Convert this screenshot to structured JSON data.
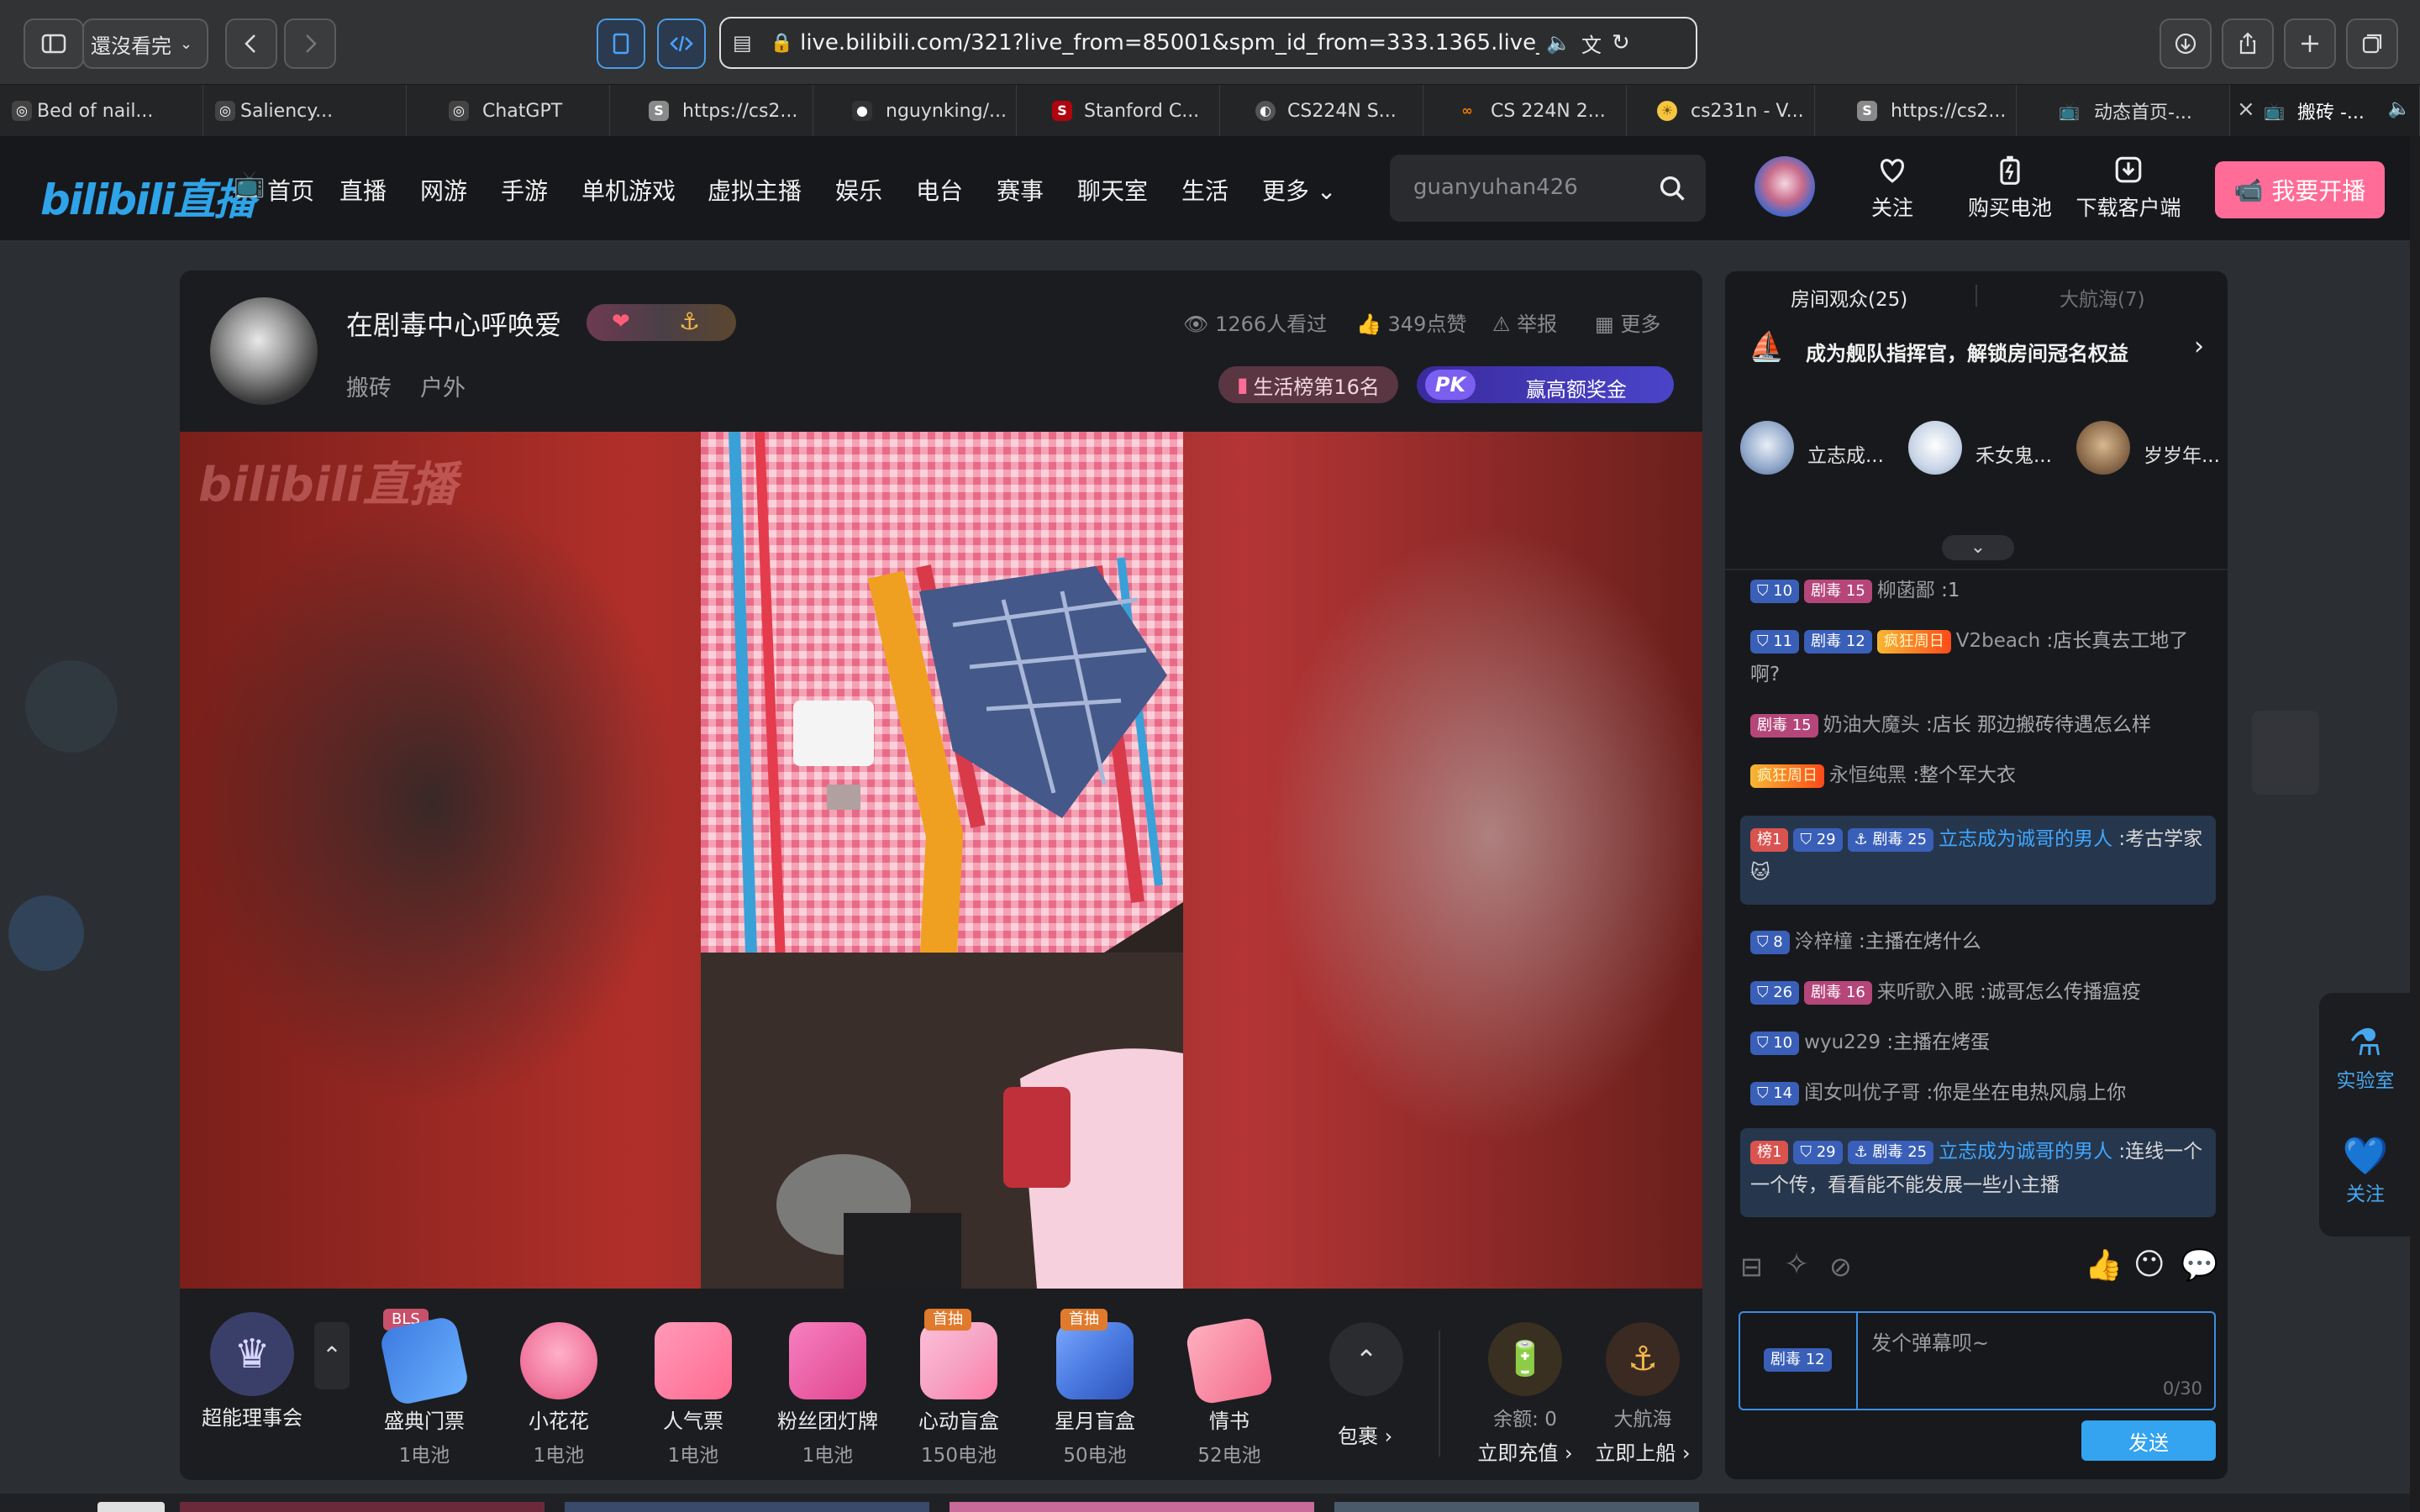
{
  "browser": {
    "reader_label": "還沒看完",
    "url": "live.bilibili.com/321?live_from=85001&spm_id_from=333.1365.live_users",
    "tabs": [
      {
        "title": "Bed of nail...",
        "icon": "chatgpt-icon",
        "color": "#ffffff"
      },
      {
        "title": "Saliency...",
        "icon": "chatgpt-icon",
        "color": "#ffffff"
      },
      {
        "title": "ChatGPT",
        "icon": "chatgpt-icon",
        "color": "#ffffff"
      },
      {
        "title": "https://cs2...",
        "icon": "s-icon",
        "color": "#8a8a8a"
      },
      {
        "title": "nguynking/...",
        "icon": "github-icon",
        "color": "#ffffff"
      },
      {
        "title": "Stanford C...",
        "icon": "stanford-icon",
        "color": "#b1040e"
      },
      {
        "title": "CS224N S...",
        "icon": "circle-icon",
        "color": "#ffffff"
      },
      {
        "title": "CS 224N 2...",
        "icon": "infinity-icon",
        "color": "#f57c00"
      },
      {
        "title": "cs231n - V...",
        "icon": "sun-icon",
        "color": "#f5c542"
      },
      {
        "title": "https://cs2...",
        "icon": "s-icon",
        "color": "#8a8a8a"
      },
      {
        "title": "动态首页-...",
        "icon": "bilibili-icon",
        "color": "#2fa3e8"
      },
      {
        "title": "搬砖 -...",
        "icon": "bilibili-icon",
        "color": "#2fa3e8"
      }
    ]
  },
  "header": {
    "logo": "bilibili直播",
    "nav": [
      "首页",
      "直播",
      "网游",
      "手游",
      "单机游戏",
      "虚拟主播",
      "娱乐",
      "电台",
      "赛事",
      "聊天室",
      "生活",
      "更多"
    ],
    "search_placeholder": "guanyuhan426",
    "actions": [
      "关注",
      "购买电池",
      "下载客户端"
    ],
    "start_live": "我要开播"
  },
  "room": {
    "title": "在剧毒中心呼唤爱",
    "tags": [
      "搬砖",
      "户外"
    ],
    "views": "1266人看过",
    "likes": "349点赞",
    "report": "举报",
    "more": "更多",
    "rank": "生活榜第16名",
    "pk_label": "PK",
    "pk_text": "赢高额奖金",
    "watermark": "bilibili直播"
  },
  "gifts": {
    "left_item": {
      "name": "超能理事会"
    },
    "items": [
      {
        "name": "盛典门票",
        "price": "1电池",
        "tag": "BLS",
        "tag_color": "#c8506a",
        "color": "#3d7be0"
      },
      {
        "name": "小花花",
        "price": "1电池",
        "tag": "",
        "color": "#f27aa0"
      },
      {
        "name": "人气票",
        "price": "1电池",
        "tag": "",
        "color": "#ff7aa6"
      },
      {
        "name": "粉丝团灯牌",
        "price": "1电池",
        "tag": "",
        "color": "#ef5fa5"
      },
      {
        "name": "心动盲盒",
        "price": "150电池",
        "tag": "首抽",
        "tag_color": "#e07a2c",
        "color": "#f6a4c4"
      },
      {
        "name": "星月盲盒",
        "price": "50电池",
        "tag": "首抽",
        "tag_color": "#e07a2c",
        "color": "#4a7ae0"
      },
      {
        "name": "情书",
        "price": "52电池",
        "tag": "",
        "color": "#f26a8a"
      }
    ],
    "bag": "包裹",
    "balance": "余额: 0",
    "recharge": "立即充值",
    "guard": "大航海",
    "board": "立即上船"
  },
  "chat": {
    "tab_audience": "房间观众(25)",
    "tab_guard": "大航海(7)",
    "guard_banner": "成为舰队指挥官，解锁房间冠名权益",
    "viewers": [
      {
        "name": "立志成...",
        "color": "#8fa6c8"
      },
      {
        "name": "禾女鬼...",
        "color": "#c8d4e6"
      },
      {
        "name": "岁岁年...",
        "color": "#8a6a4a"
      }
    ],
    "messages": [
      {
        "level": "10",
        "medal": "剧毒",
        "medal_lv": "15",
        "name": "柳菡鄙",
        "text": ":1",
        "hl": false
      },
      {
        "level": "11",
        "medal": "剧毒",
        "medal_lv": "12",
        "title": "疯狂周日",
        "name": "V2beach",
        "text": ":店长真去工地了啊?",
        "hl": false
      },
      {
        "level": "",
        "medal": "剧毒",
        "medal_lv": "15",
        "name": "奶油大魔头",
        "text": ":店长 那边搬砖待遇怎么样",
        "hl": false
      },
      {
        "level": "",
        "medal": "",
        "title": "疯狂周日",
        "name": "永恒纯黑",
        "text": ":整个军大衣",
        "hl": false
      },
      {
        "rank": "榜1",
        "level": "29",
        "medal": "剧毒",
        "medal_lv": "25",
        "name": "立志成为诚哥的男人",
        "text": ":考古学家🐱",
        "hl": true
      },
      {
        "level": "8",
        "medal": "",
        "name": "泠梓橦",
        "text": ":主播在烤什么",
        "hl": false
      },
      {
        "level": "26",
        "medal": "剧毒",
        "medal_lv": "16",
        "name": "来听歌入眠",
        "text": ":诚哥怎么传播瘟疫",
        "hl": false
      },
      {
        "level": "10",
        "medal": "",
        "name": "wyu229",
        "text": ":主播在烤蛋",
        "hl": false
      },
      {
        "level": "14",
        "medal": "",
        "name": "闺女叫优子哥",
        "text": ":你是坐在电热风扇上你",
        "hl": false
      },
      {
        "rank": "榜1",
        "level": "29",
        "medal": "剧毒",
        "medal_lv": "25",
        "name": "立志成为诚哥的男人",
        "text": ":连线一个一个传，看看能不能发展一些小主播",
        "hl": true
      }
    ],
    "input_medal": "剧毒",
    "input_medal_lv": "12",
    "input_placeholder": "发个弹幕呗~",
    "counter": "0/30",
    "send": "发送"
  },
  "side_panel": {
    "lab": "实验室",
    "follow": "关注"
  }
}
